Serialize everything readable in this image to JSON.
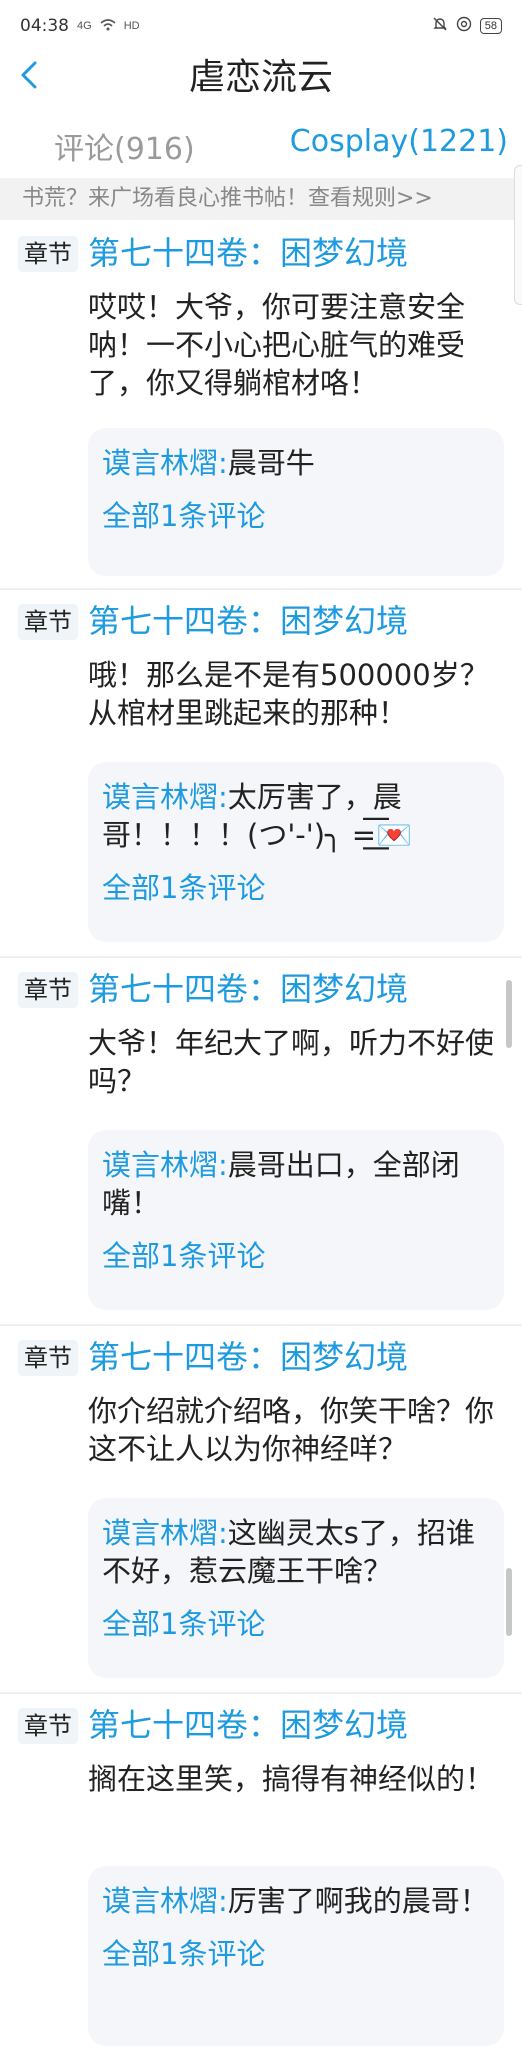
{
  "status": {
    "time": "04:38",
    "net_label": "4G",
    "hd_label": "HD",
    "battery": "58"
  },
  "header": {
    "title": "虐恋流云"
  },
  "tabs": [
    {
      "label": "评论(916)"
    },
    {
      "label": "Cosplay(1221)"
    }
  ],
  "notice": {
    "text": "书荒？来广场看良心推书帖！查看规则>>",
    "arrow": "›"
  },
  "posts": [
    {
      "badge": "章节",
      "chapter": "第七十四卷：困梦幻境",
      "text": "哎哎！大爷，你可要注意安全呐！一不小心把心脏气的难受了，你又得躺棺材咯！",
      "reply_author": "谟言林熠:",
      "reply_text": "晨哥牛",
      "reply_more": "全部1条评论"
    },
    {
      "badge": "章节",
      "chapter": "第七十四卷：困梦幻境",
      "text": "哦！那么是不是有500000岁？从棺材里跳起来的那种！",
      "reply_author": "谟言林熠:",
      "reply_text": "太厉害了，晨哥！！！！(つ'-')╮ =͟͟͞͞💌",
      "reply_more": "全部1条评论"
    },
    {
      "badge": "章节",
      "chapter": "第七十四卷：困梦幻境",
      "text": "大爷！年纪大了啊，听力不好使吗？",
      "reply_author": "谟言林熠:",
      "reply_text": "晨哥出口，全部闭嘴！",
      "reply_more": "全部1条评论"
    },
    {
      "badge": "章节",
      "chapter": "第七十四卷：困梦幻境",
      "text": "你介绍就介绍咯，你笑干啥？你这不让人以为你神经咩？",
      "reply_author": "谟言林熠:",
      "reply_text": "这幽灵太s了，招谁不好，惹云魔王干啥？",
      "reply_more": "全部1条评论"
    },
    {
      "badge": "章节",
      "chapter": "第七十四卷：困梦幻境",
      "text": "搁在这里笑，搞得有神经似的！",
      "reply_author": "谟言林熠:",
      "reply_text": "厉害了啊我的晨哥！",
      "reply_more": "全部1条评论"
    }
  ]
}
